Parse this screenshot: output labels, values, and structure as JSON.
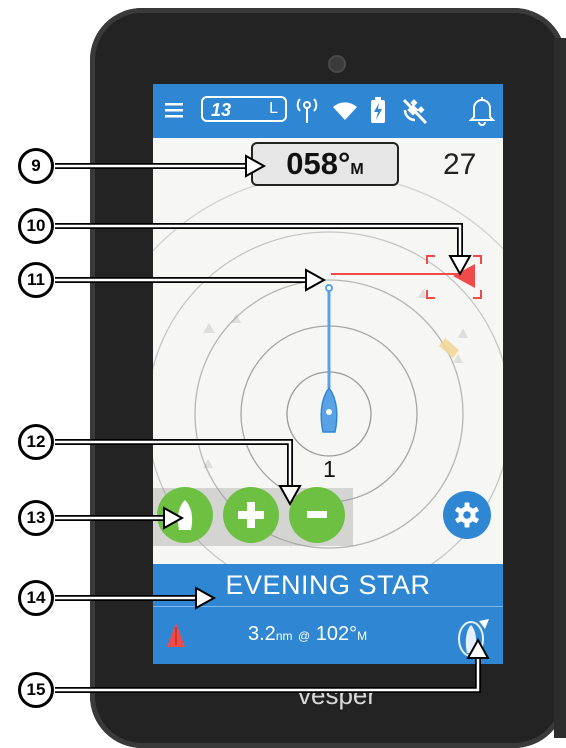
{
  "status_bar": {
    "channel": "13",
    "power": "L",
    "icons": [
      "menu-icon",
      "antenna-icon",
      "wifi-icon",
      "battery-charging-icon",
      "gps-off-icon",
      "alarm-bell-icon"
    ]
  },
  "radar": {
    "heading_value": "058°",
    "heading_unit": "M",
    "range_label": "27",
    "zoom_level": "1"
  },
  "buttons": {
    "icons": [
      "boat-icon",
      "plus-icon",
      "minus-icon",
      "gear-icon"
    ]
  },
  "target": {
    "name": "EVENING STAR",
    "distance": "3.2",
    "distance_unit": "nm",
    "at": "@",
    "bearing": "102°",
    "bearing_unit": "M"
  },
  "device": {
    "brand": "vesper"
  },
  "callouts": [
    "9",
    "10",
    "11",
    "12",
    "13",
    "14",
    "15"
  ],
  "colors": {
    "accent_blue": "#2f87d3",
    "button_green": "#6ec043",
    "target_red": "#f04a4a",
    "own_ship_blue": "#5aa2e6"
  }
}
